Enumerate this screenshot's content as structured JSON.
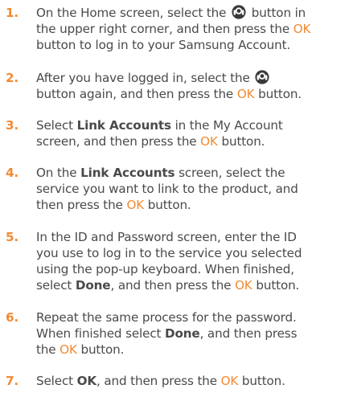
{
  "steps": [
    {
      "number": "1.",
      "lines": [
        [
          "On the Home screen, select the ",
          {
            "icon": "account-icon"
          },
          " button in"
        ],
        [
          "the upper right corner, and then press the ",
          {
            "ok": "OK"
          }
        ],
        [
          "button to log in to your Samsung Account."
        ]
      ]
    },
    {
      "number": "2.",
      "lines": [
        [
          "After you have logged in, select the ",
          {
            "icon": "account-icon"
          }
        ],
        [
          "button again, and then press the ",
          {
            "ok": "OK"
          },
          " button."
        ]
      ]
    },
    {
      "number": "3.",
      "lines": [
        [
          "Select ",
          {
            "bold": "Link Accounts"
          },
          " in the My Account"
        ],
        [
          "screen, and then press the ",
          {
            "ok": "OK"
          },
          " button."
        ]
      ]
    },
    {
      "number": "4.",
      "lines": [
        [
          "On the ",
          {
            "bold": "Link Accounts"
          },
          " screen, select the"
        ],
        [
          "service you want to link to the product, and"
        ],
        [
          "then press the ",
          {
            "ok": "OK"
          },
          " button."
        ]
      ]
    },
    {
      "number": "5.",
      "lines": [
        [
          "In the ID and Password screen, enter the ID"
        ],
        [
          "you use to log in to the service you selected"
        ],
        [
          "using the pop-up keyboard. When finished,"
        ],
        [
          "select ",
          {
            "bold": "Done"
          },
          ", and then press the ",
          {
            "ok": "OK"
          },
          " button."
        ]
      ]
    },
    {
      "number": "6.",
      "lines": [
        [
          "Repeat the same process for the password."
        ],
        [
          "When finished select ",
          {
            "bold": "Done"
          },
          ", and then press"
        ],
        [
          "the ",
          {
            "ok": "OK"
          },
          " button."
        ]
      ]
    },
    {
      "number": "7.",
      "lines": [
        [
          "Select ",
          {
            "bold": "OK"
          },
          ", and then press the ",
          {
            "ok": "OK"
          },
          " button."
        ]
      ]
    }
  ],
  "colors": {
    "accent": "#f28a32",
    "text": "#4a4a4a"
  }
}
